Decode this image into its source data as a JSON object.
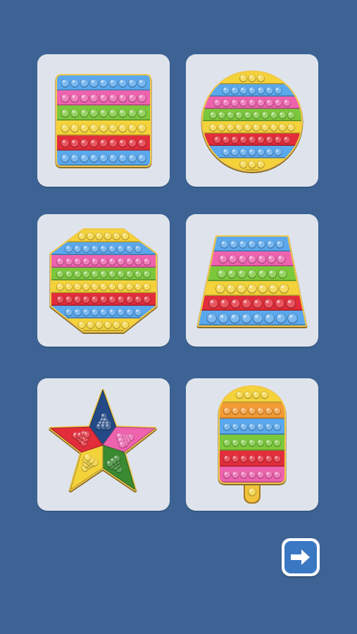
{
  "app": {
    "screen": "pop-it-shape-select",
    "background": "#3d6394"
  },
  "palette": {
    "blue": "#5aa8ee",
    "pink": "#ee62ae",
    "green": "#7cc83c",
    "yellow": "#f4d23a",
    "red": "#e32d3a",
    "orange": "#f49a34",
    "navy": "#234a86",
    "dark_green": "#3a8a32"
  },
  "shapes": [
    {
      "id": "square",
      "stripes": [
        "blue",
        "pink",
        "green",
        "yellow",
        "red",
        "blue"
      ]
    },
    {
      "id": "circle",
      "stripes": [
        "yellow",
        "blue",
        "pink",
        "green",
        "yellow",
        "red",
        "blue",
        "yellow"
      ]
    },
    {
      "id": "octagon",
      "stripes": [
        "yellow",
        "blue",
        "pink",
        "green",
        "yellow",
        "red",
        "blue",
        "yellow"
      ]
    },
    {
      "id": "trapezoid",
      "stripes": [
        "blue",
        "pink",
        "green",
        "yellow",
        "red",
        "blue"
      ]
    },
    {
      "id": "star",
      "sections": [
        "navy",
        "pink",
        "dark_green",
        "yellow",
        "red"
      ]
    },
    {
      "id": "popsicle",
      "stripes": [
        "yellow",
        "orange",
        "blue",
        "green",
        "red",
        "pink"
      ]
    }
  ],
  "next_button": {
    "icon": "arrow-right-icon"
  }
}
